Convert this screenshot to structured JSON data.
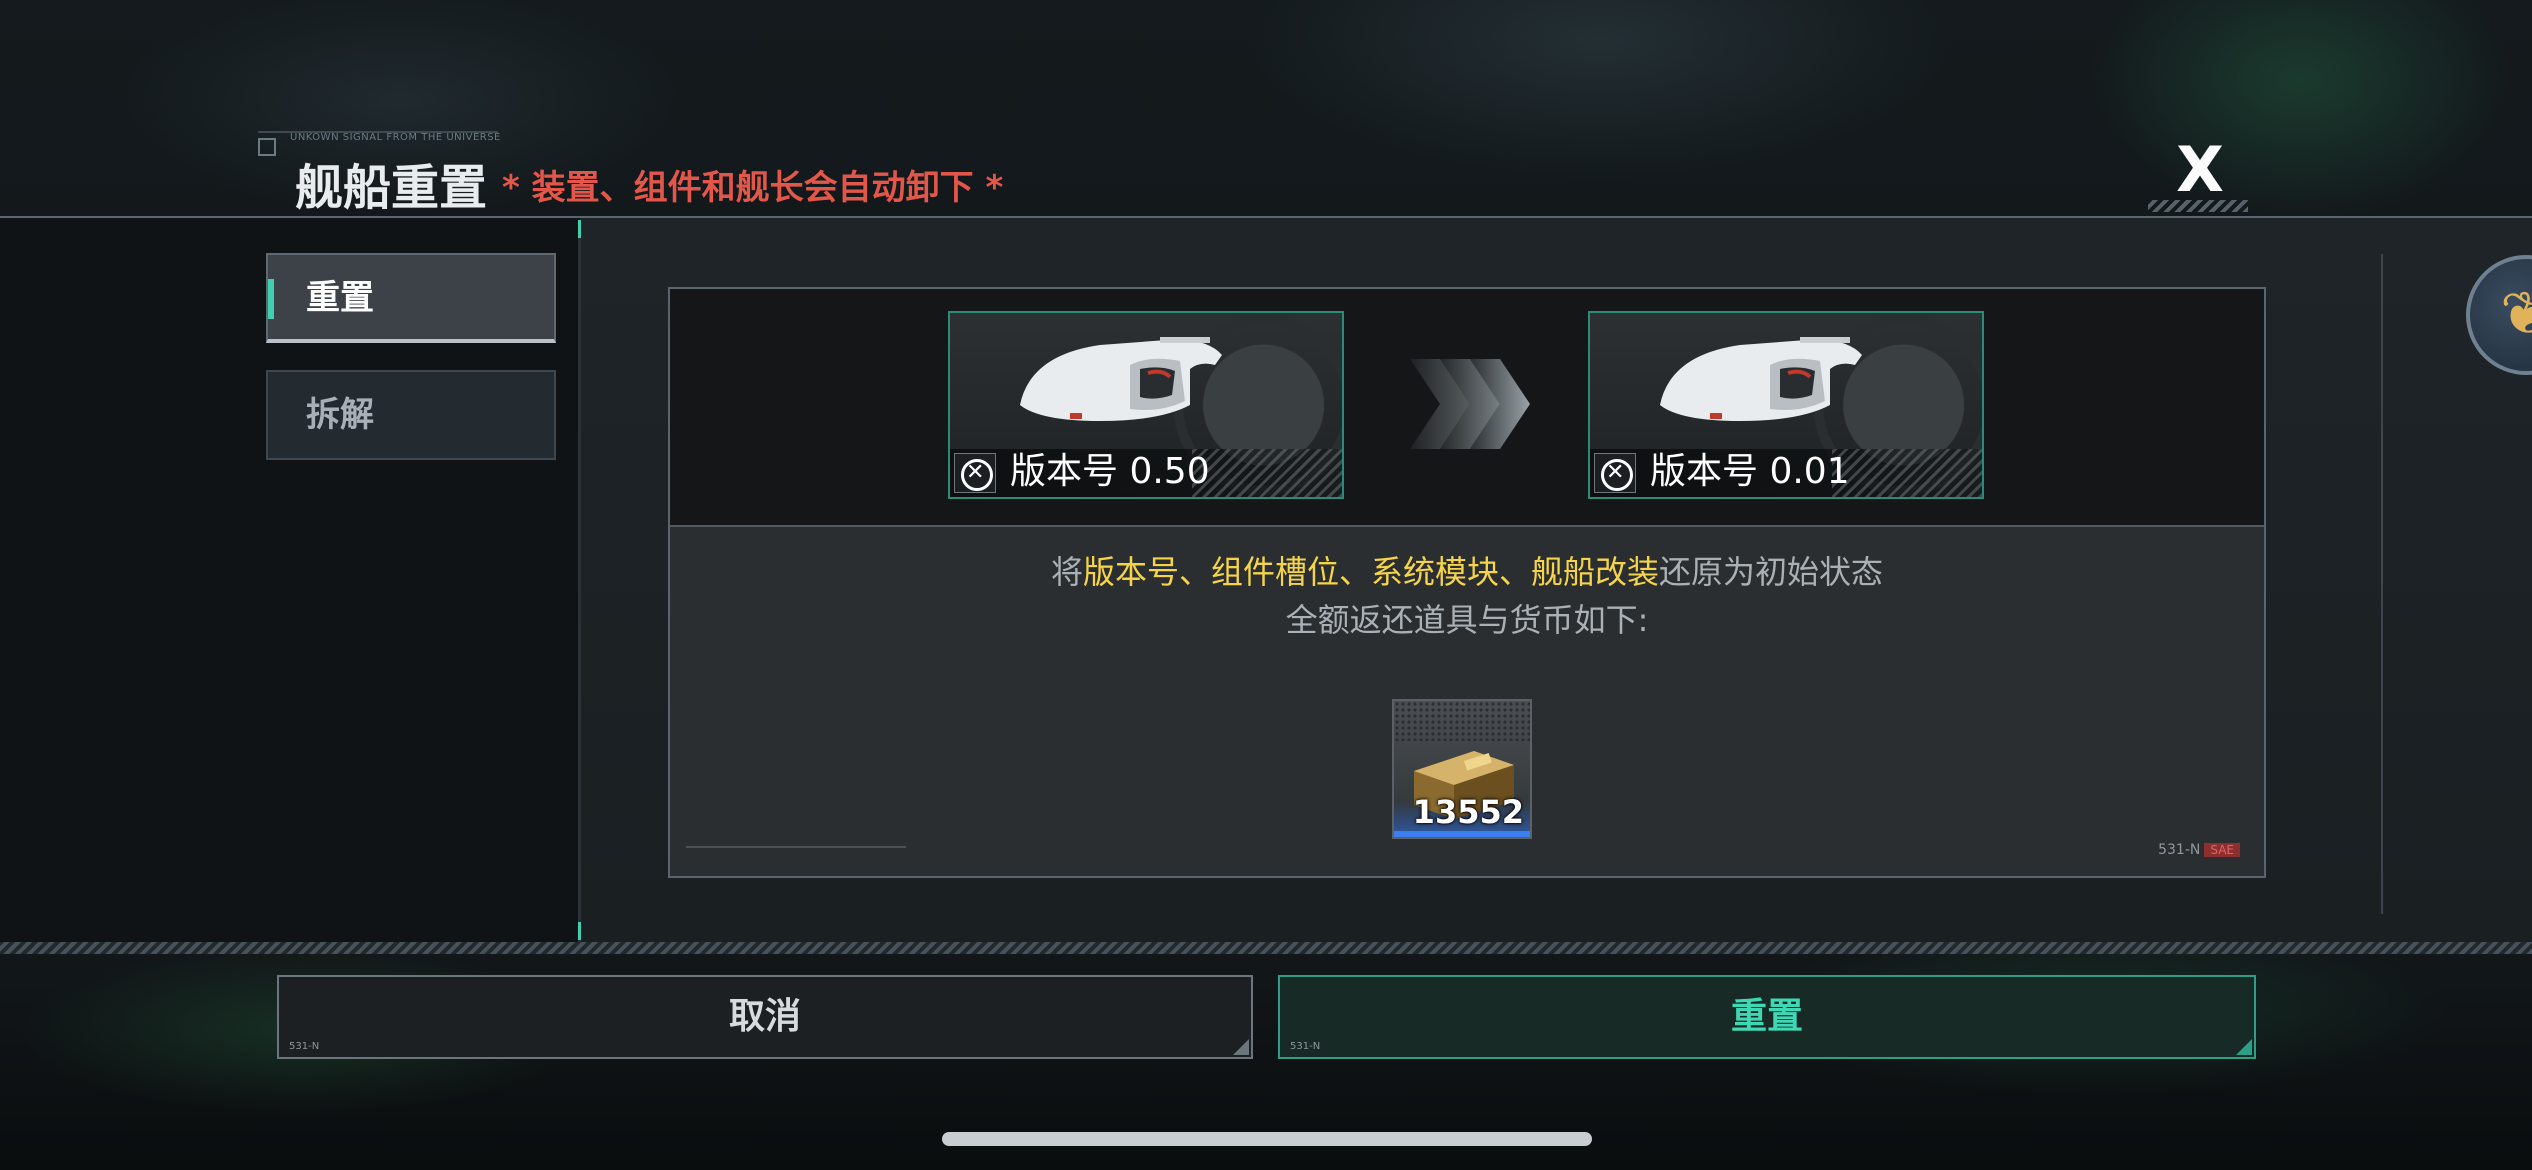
{
  "header": {
    "tag": "UNKOWN SIGNAL FROM THE UNIVERSE",
    "title": "舰船重置",
    "warning": "* 装置、组件和舰长会自动卸下 *",
    "close_label": "X"
  },
  "tabs": [
    {
      "label": "重置",
      "active": true
    },
    {
      "label": "拆解",
      "active": false
    }
  ],
  "ships": {
    "before": {
      "version": "版本号 0.50"
    },
    "after": {
      "version": "版本号 0.01"
    }
  },
  "description": {
    "prefix": "将",
    "highlight": "版本号、组件槽位、系统模块、舰船改装",
    "suffix": "还原为初始状态",
    "line2": "全额返还道具与货币如下:"
  },
  "refund_items": [
    {
      "icon": "gold-crate-icon",
      "count": "13552"
    }
  ],
  "panel_code": {
    "code": "531-N",
    "tag": "SAE"
  },
  "buttons": {
    "cancel": "取消",
    "reset": "重置",
    "code": "531-N"
  },
  "colors": {
    "accent": "#3fd0b0",
    "warning": "#e2574a",
    "highlight": "#f5d44a"
  }
}
